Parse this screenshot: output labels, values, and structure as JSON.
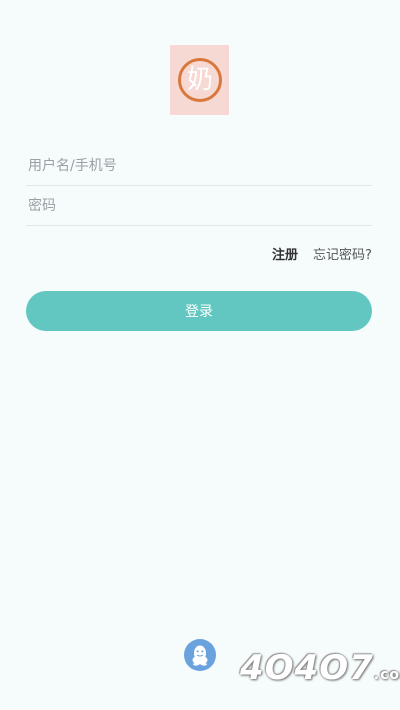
{
  "app": {
    "logo_char": "奶",
    "colors": {
      "background": "#f6fbfc",
      "logo_bg": "#f7d9d4",
      "logo_ring": "#d9783d",
      "accent": "#62c7c0",
      "qq_icon": "#6aa2dd"
    }
  },
  "form": {
    "username_placeholder": "用户名/手机号",
    "password_placeholder": "密码",
    "register_label": "注册",
    "forgot_label": "忘记密码?",
    "login_label": "登录"
  },
  "footer": {
    "qq_icon": "qq-icon"
  },
  "watermark": {
    "main": "4O4O7",
    "suffix": ".com"
  }
}
